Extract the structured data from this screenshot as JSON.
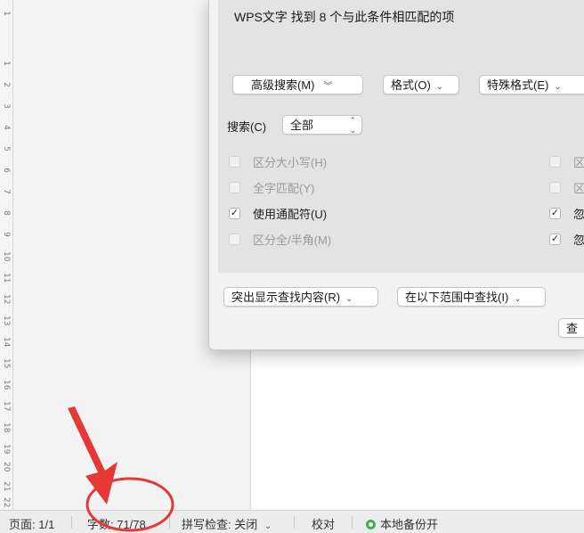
{
  "ruler": {
    "numbers": [
      "1",
      "1",
      "2",
      "3",
      "4",
      "5",
      "6",
      "7",
      "8",
      "9",
      "10",
      "11",
      "12",
      "13",
      "14",
      "15",
      "16",
      "17",
      "18",
      "19",
      "20",
      "21",
      "22"
    ]
  },
  "dialog": {
    "message": "WPS文字 找到 8 个与此条件相匹配的项",
    "advanced_search_label": "高级搜索(M)",
    "format_label": "格式(O)",
    "special_format_label": "特殊格式(E)",
    "search_label": "搜索(C)",
    "search_scope_value": "全部",
    "options_left": [
      {
        "label": "区分大小写(H)",
        "checked": false,
        "disabled": true
      },
      {
        "label": "全字匹配(Y)",
        "checked": false,
        "disabled": true
      },
      {
        "label": "使用通配符(U)",
        "checked": true,
        "disabled": false
      },
      {
        "label": "区分全/半角(M)",
        "checked": false,
        "disabled": true
      }
    ],
    "options_right": [
      {
        "label": "区",
        "checked": false,
        "disabled": true
      },
      {
        "label": "区",
        "checked": false,
        "disabled": true
      },
      {
        "label": "忽",
        "checked": true,
        "disabled": false
      },
      {
        "label": "忽",
        "checked": true,
        "disabled": false
      }
    ],
    "highlight_label": "突出显示查找内容(R)",
    "find_in_label": "在以下范围中查找(I)",
    "find_button_label": "查"
  },
  "statusbar": {
    "page": "页面: 1/1",
    "word_count": "字数: 71/78",
    "spell_check": "拼写检查: 关闭",
    "proofread": "校对",
    "local_backup": "本地备份开"
  },
  "colors": {
    "annotation_red": "#e53935",
    "backup_green": "#3bb24a"
  }
}
